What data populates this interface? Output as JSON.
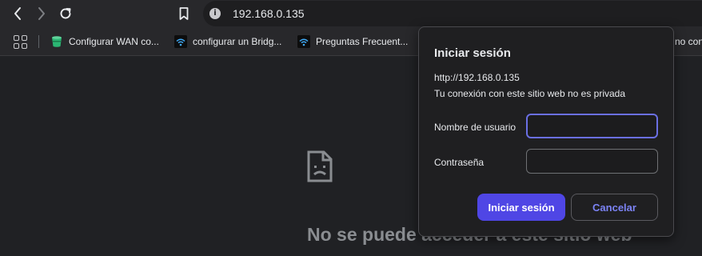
{
  "toolbar": {
    "url": "192.168.0.135"
  },
  "bookmarks": [
    {
      "label": "Configurar WAN co...",
      "icon": "shield-bucket-icon"
    },
    {
      "label": "configurar un Bridg...",
      "icon": "wifi-icon"
    },
    {
      "label": "Preguntas Frecuent...",
      "icon": "wifi-icon"
    },
    {
      "label": "no conf",
      "icon": ""
    }
  ],
  "page": {
    "error_title": "No se puede acceder a este sitio web"
  },
  "dialog": {
    "title": "Iniciar sesión",
    "origin": "http://192.168.0.135",
    "warning": "Tu conexión con este sitio web no es privada",
    "username_label": "Nombre de usuario",
    "username_value": "",
    "password_label": "Contraseña",
    "password_value": "",
    "submit_label": "Iniciar sesión",
    "cancel_label": "Cancelar"
  },
  "colors": {
    "accent": "#4f46e5",
    "accent_text": "#7c83f5",
    "background": "#202124"
  }
}
